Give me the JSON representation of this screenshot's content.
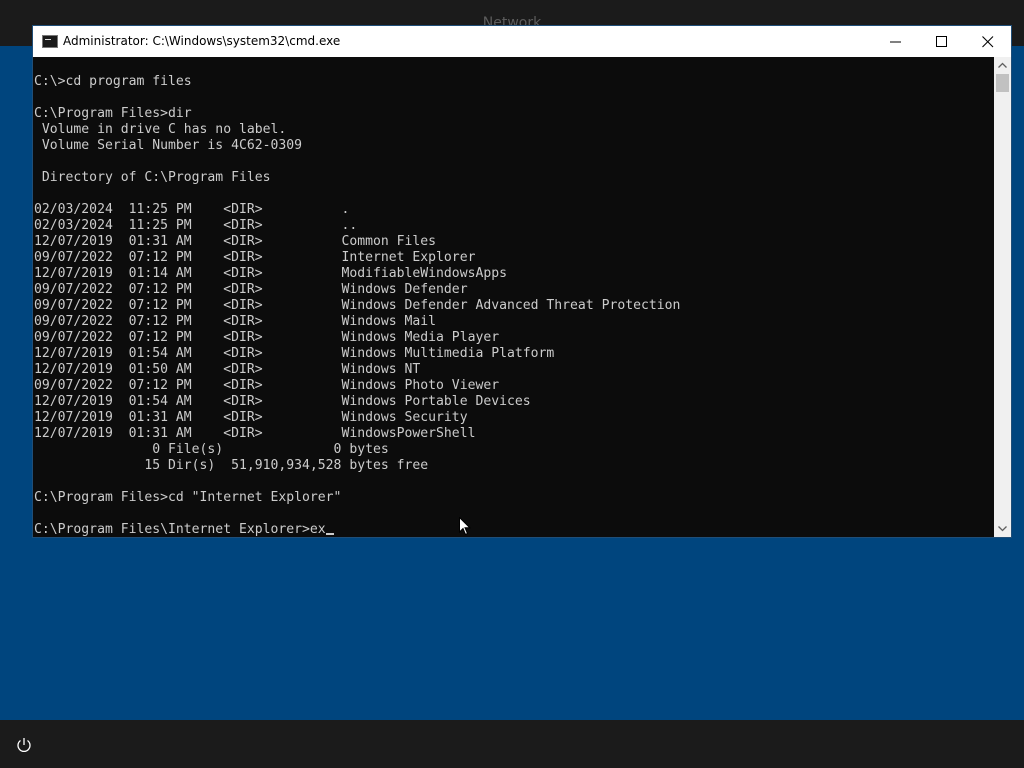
{
  "desktop": {
    "top_title": "Network"
  },
  "window": {
    "title": "Administrator: C:\\Windows\\system32\\cmd.exe",
    "icon": "cmd-icon",
    "buttons": {
      "minimize": "minimize-icon",
      "maximize": "maximize-icon",
      "close": "close-icon"
    }
  },
  "console": {
    "lines": [
      "C:\\>cd program files",
      "",
      "C:\\Program Files>dir",
      " Volume in drive C has no label.",
      " Volume Serial Number is 4C62-0309",
      "",
      " Directory of C:\\Program Files",
      "",
      "02/03/2024  11:25 PM    <DIR>          .",
      "02/03/2024  11:25 PM    <DIR>          ..",
      "12/07/2019  01:31 AM    <DIR>          Common Files",
      "09/07/2022  07:12 PM    <DIR>          Internet Explorer",
      "12/07/2019  01:14 AM    <DIR>          ModifiableWindowsApps",
      "09/07/2022  07:12 PM    <DIR>          Windows Defender",
      "09/07/2022  07:12 PM    <DIR>          Windows Defender Advanced Threat Protection",
      "09/07/2022  07:12 PM    <DIR>          Windows Mail",
      "09/07/2022  07:12 PM    <DIR>          Windows Media Player",
      "12/07/2019  01:54 AM    <DIR>          Windows Multimedia Platform",
      "12/07/2019  01:50 AM    <DIR>          Windows NT",
      "09/07/2022  07:12 PM    <DIR>          Windows Photo Viewer",
      "12/07/2019  01:54 AM    <DIR>          Windows Portable Devices",
      "12/07/2019  01:31 AM    <DIR>          Windows Security",
      "12/07/2019  01:31 AM    <DIR>          WindowsPowerShell",
      "               0 File(s)              0 bytes",
      "              15 Dir(s)  51,910,934,528 bytes free",
      "",
      "C:\\Program Files>cd \"Internet Explorer\"",
      ""
    ],
    "prompt_line": "C:\\Program Files\\Internet Explorer>ex"
  },
  "taskbar": {
    "power_icon": "power-icon"
  },
  "colors": {
    "desktop_bg": "#00457e",
    "bar_bg": "#1b1b1b",
    "console_bg": "#0c0c0c",
    "console_text": "#cccccc"
  }
}
